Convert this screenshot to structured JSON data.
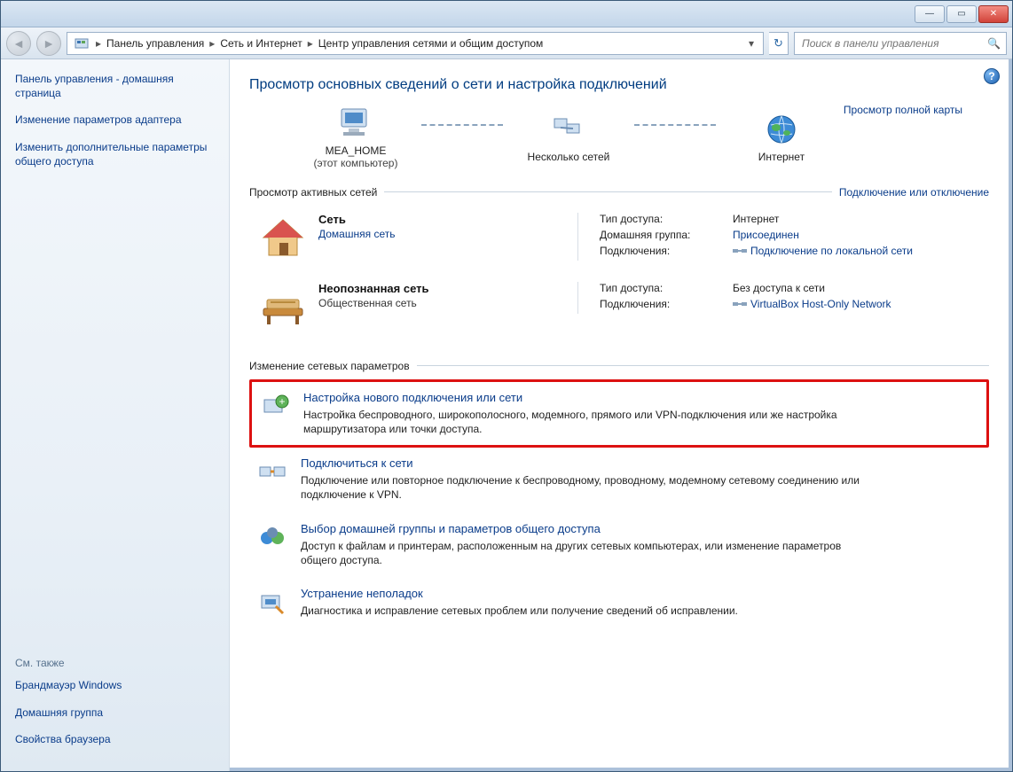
{
  "titlebar": {
    "min": "—",
    "max": "▭",
    "close": "✕"
  },
  "address": {
    "segments": [
      "Панель управления",
      "Сеть и Интернет",
      "Центр управления сетями и общим доступом"
    ],
    "refresh_glyph": "↻"
  },
  "search": {
    "placeholder": "Поиск в панели управления",
    "mag": "🔍"
  },
  "sidebar": {
    "links": [
      "Панель управления - домашняя страница",
      "Изменение параметров адаптера",
      "Изменить дополнительные параметры общего доступа"
    ],
    "see_also_heading": "См. также",
    "see_also": [
      "Брандмауэр Windows",
      "Домашняя группа",
      "Свойства браузера"
    ]
  },
  "main": {
    "help_glyph": "?",
    "title": "Просмотр основных сведений о сети и настройка подключений",
    "map": {
      "node1": {
        "name": "MEA_HOME",
        "sub": "(этот компьютер)"
      },
      "node2": {
        "name": "Несколько сетей"
      },
      "node3": {
        "name": "Интернет"
      },
      "full_map_link": "Просмотр полной карты"
    },
    "active_nets_heading": "Просмотр активных сетей",
    "connect_disconnect": "Подключение или отключение",
    "networks": [
      {
        "name": "Сеть",
        "type_label": "Домашняя сеть",
        "type_is_link": true,
        "details": [
          {
            "k": "Тип доступа:",
            "v": "Интернет",
            "link": false
          },
          {
            "k": "Домашняя группа:",
            "v": "Присоединен",
            "link": true
          },
          {
            "k": "Подключения:",
            "v": "Подключение по локальной сети",
            "link": true,
            "lan_icon": true
          }
        ]
      },
      {
        "name": "Неопознанная сеть",
        "type_label": "Общественная сеть",
        "type_is_link": false,
        "details": [
          {
            "k": "Тип доступа:",
            "v": "Без доступа к сети",
            "link": false
          },
          {
            "k": "Подключения:",
            "v": "VirtualBox Host-Only Network",
            "link": true,
            "lan_icon": true
          }
        ]
      }
    ],
    "settings_heading": "Изменение сетевых параметров",
    "tasks": [
      {
        "title": "Настройка нового подключения или сети",
        "desc": "Настройка беспроводного, широкополосного, модемного, прямого или VPN-подключения или же настройка маршрутизатора или точки доступа.",
        "highlight": true
      },
      {
        "title": "Подключиться к сети",
        "desc": "Подключение или повторное подключение к беспроводному, проводному, модемному сетевому соединению или подключение к VPN.",
        "highlight": false
      },
      {
        "title": "Выбор домашней группы и параметров общего доступа",
        "desc": "Доступ к файлам и принтерам, расположенным на других сетевых компьютерах, или изменение параметров общего доступа.",
        "highlight": false
      },
      {
        "title": "Устранение неполадок",
        "desc": "Диагностика и исправление сетевых проблем или получение сведений об исправлении.",
        "highlight": false
      }
    ]
  }
}
